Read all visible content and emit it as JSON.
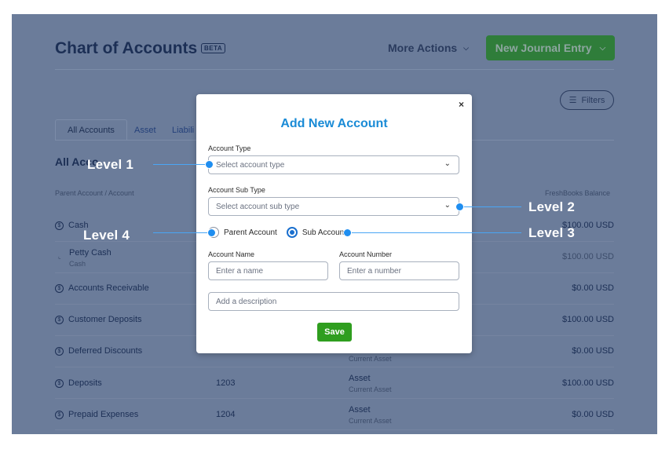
{
  "header": {
    "title": "Chart of Accounts",
    "beta": "BETA",
    "more_actions": "More Actions",
    "new_journal_entry": "New Journal Entry",
    "filters": "Filters"
  },
  "tabs": [
    "All Accounts",
    "Asset",
    "Liabili"
  ],
  "section_title": "All Acco",
  "columns": {
    "left": "Parent Account / Account",
    "right": "FreshBooks Balance"
  },
  "rows": [
    {
      "name": "Cash",
      "number": "",
      "type": "",
      "subtype": "",
      "balance": "$100.00 USD"
    },
    {
      "name": "Petty Cash",
      "parent": "Cash",
      "number": "",
      "type": "",
      "subtype": "",
      "balance": "$100.00 USD"
    },
    {
      "name": "Accounts Receivable",
      "number": "",
      "type": "",
      "subtype": "",
      "balance": "$0.00 USD"
    },
    {
      "name": "Customer Deposits",
      "number": "",
      "type": "",
      "subtype": "",
      "balance": "$100.00 USD"
    },
    {
      "name": "Deferred Discounts",
      "number": "",
      "type": "",
      "subtype": "Current Asset",
      "balance": "$0.00 USD"
    },
    {
      "name": "Deposits",
      "number": "1203",
      "type": "Asset",
      "subtype": "Current Asset",
      "balance": "$100.00 USD"
    },
    {
      "name": "Prepaid Expenses",
      "number": "1204",
      "type": "Asset",
      "subtype": "Current Asset",
      "balance": "$0.00 USD"
    }
  ],
  "modal": {
    "close": "×",
    "title": "Add New Account",
    "account_type_label": "Account Type",
    "account_type_placeholder": "Select account type",
    "account_sub_type_label": "Account Sub Type",
    "account_sub_type_placeholder": "Select account sub type",
    "parent_account": "Parent Account",
    "sub_account": "Sub Account",
    "account_name_label": "Account Name",
    "account_name_placeholder": "Enter a name",
    "account_number_label": "Account Number",
    "account_number_placeholder": "Enter a number",
    "description_placeholder": "Add a description",
    "save": "Save",
    "selected_radio": "Sub Account"
  },
  "callouts": {
    "level1": "Level 1",
    "level2": "Level 2",
    "level3": "Level 3",
    "level4": "Level 4"
  },
  "colors": {
    "overlay": "#6b7c9a",
    "accent": "#1a8bd6",
    "save": "#2f9e1f",
    "callout_dot": "#1f8ef0"
  }
}
